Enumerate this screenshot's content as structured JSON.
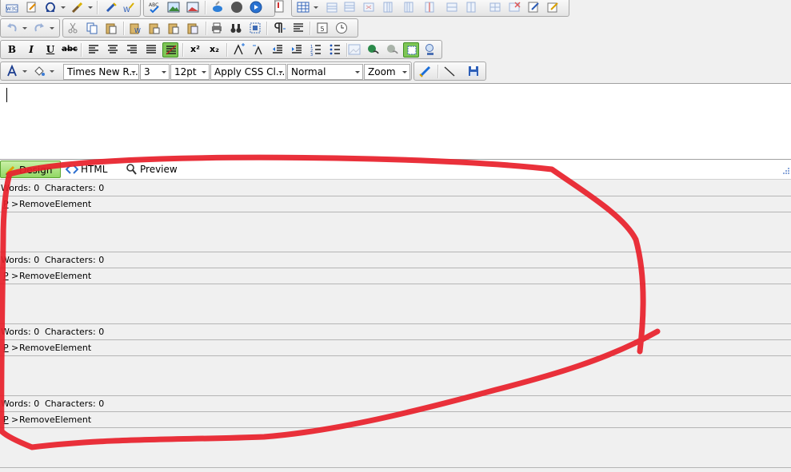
{
  "toolbar": {
    "font_name": "Times New R...",
    "font_size": "3",
    "point_size": "12pt",
    "css_class": "Apply CSS Cl...",
    "paragraph_format": "Normal",
    "zoom": "Zoom",
    "bold_label": "B",
    "italic_label": "I",
    "underline_label": "U",
    "strike_label": "abc",
    "superscript_label": "x²",
    "subscript_label": "x₂",
    "w3c_label": "W3C",
    "spell_label": "ABC"
  },
  "mode_tabs": [
    {
      "label": "Design"
    },
    {
      "label": "HTML"
    },
    {
      "label": "Preview"
    }
  ],
  "status_blocks": [
    {
      "words_label": "Words: 0",
      "chars_label": "Characters: 0",
      "tag": "P",
      "separator": ">",
      "element": "RemoveElement"
    },
    {
      "words_label": "Words: 0",
      "chars_label": "Characters: 0",
      "tag": "P",
      "separator": ">",
      "element": "RemoveElement"
    },
    {
      "words_label": "Words: 0",
      "chars_label": "Characters: 0",
      "tag": "P",
      "separator": ">",
      "element": "RemoveElement"
    },
    {
      "words_label": "Words: 0",
      "chars_label": "Characters: 0",
      "tag": "P",
      "separator": ">",
      "element": "RemoveElement"
    }
  ],
  "colors": {
    "annotation": "#e8202a",
    "active_green": "#7ec655",
    "toolbar_bg": "#e4e4e4"
  }
}
